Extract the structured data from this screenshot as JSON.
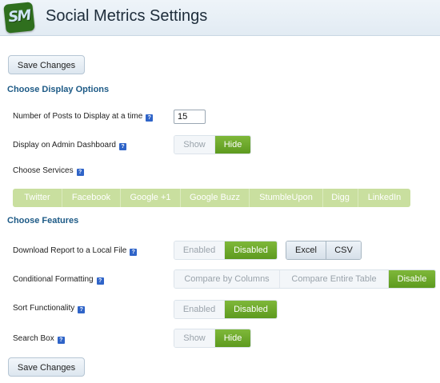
{
  "header": {
    "logo_text": "SM",
    "title": "Social Metrics Settings"
  },
  "save_label": "Save Changes",
  "sections": {
    "display": "Choose Display Options",
    "features": "Choose Features"
  },
  "help_glyph": "?",
  "display_options": {
    "posts_label": "Number of Posts to Display at a time",
    "posts_value": "15",
    "dashboard_label": "Display on Admin Dashboard",
    "dashboard_options": [
      "Show",
      "Hide"
    ],
    "dashboard_selected": "Hide",
    "services_label": "Choose Services",
    "services": [
      "Twitter",
      "Facebook",
      "Google +1",
      "Google Buzz",
      "StumbleUpon",
      "Digg",
      "LinkedIn"
    ]
  },
  "features": {
    "download_label": "Download Report to a Local File",
    "download_options": [
      "Enabled",
      "Disabled"
    ],
    "download_selected": "Disabled",
    "format_options": [
      "Excel",
      "CSV"
    ],
    "conditional_label": "Conditional Formatting",
    "conditional_options": [
      "Compare by Columns",
      "Compare Entire Table",
      "Disable"
    ],
    "conditional_selected": "Disable",
    "sort_label": "Sort Functionality",
    "sort_options": [
      "Enabled",
      "Disabled"
    ],
    "sort_selected": "Disabled",
    "search_label": "Search Box",
    "search_options": [
      "Show",
      "Hide"
    ],
    "search_selected": "Hide"
  },
  "colors": {
    "accent_green": "#6aa82a",
    "section_blue": "#1d5a86",
    "header_bg": "#e8f0f6",
    "service_green": "#c9df9f"
  }
}
